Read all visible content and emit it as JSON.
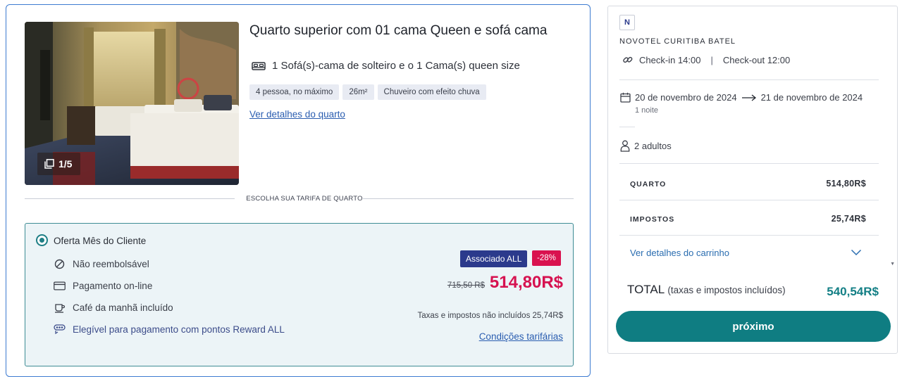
{
  "room": {
    "title": "Quarto superior com 01 cama Queen e sofá cama",
    "beds": "1 Sofá(s)-cama de solteiro e o 1 Cama(s) queen size",
    "tags": [
      "4 pessoa, no máximo",
      "26m²",
      "Chuveiro com efeito chuva"
    ],
    "details_link": "Ver detalhes do quarto",
    "photo_counter": "1/5",
    "rate_section_label": "ESCOLHA SUA TARIFA DE QUARTO"
  },
  "rate": {
    "name": "Oferta Mês do Cliente",
    "selected": true,
    "features": [
      {
        "icon": "no-refund-icon",
        "label": "Não reembolsável"
      },
      {
        "icon": "card-icon",
        "label": "Pagamento on-line"
      },
      {
        "icon": "coffee-icon",
        "label": "Café da manhã incluído"
      },
      {
        "icon": "reward-icon",
        "label": "Elegível para pagamento com pontos Reward ALL"
      }
    ],
    "member_badge": "Associado ALL",
    "discount_badge": "-28%",
    "old_price": "715,50 R$",
    "price": "514,80R$",
    "tax_note": "Taxas e impostos não incluídos 25,74R$",
    "conditions_link": "Condições tarifárias"
  },
  "summary": {
    "hotel_logo": "N",
    "hotel_name": "NOVOTEL CURITIBA BATEL",
    "check_in": "Check-in 14:00",
    "check_out": "Check-out 12:00",
    "separator": "|",
    "date_from": "20 de novembro de 2024",
    "date_to": "21 de novembro de 2024",
    "nights": "1 noite",
    "guests": "2 adultos",
    "room_label": "QUARTO",
    "room_value": "514,80R$",
    "taxes_label": "IMPOSTOS",
    "taxes_value": "25,74R$",
    "cart_link": "Ver detalhes do carrinho",
    "total_label": "TOTAL",
    "total_sub": "(taxas e impostos incluídos)",
    "total_value": "540,54R$",
    "next_button": "próximo"
  },
  "colors": {
    "accent_teal": "#0f7d82",
    "price_pink": "#d61250",
    "link_blue": "#2a5db0",
    "member_badge": "#2b3a8c"
  }
}
